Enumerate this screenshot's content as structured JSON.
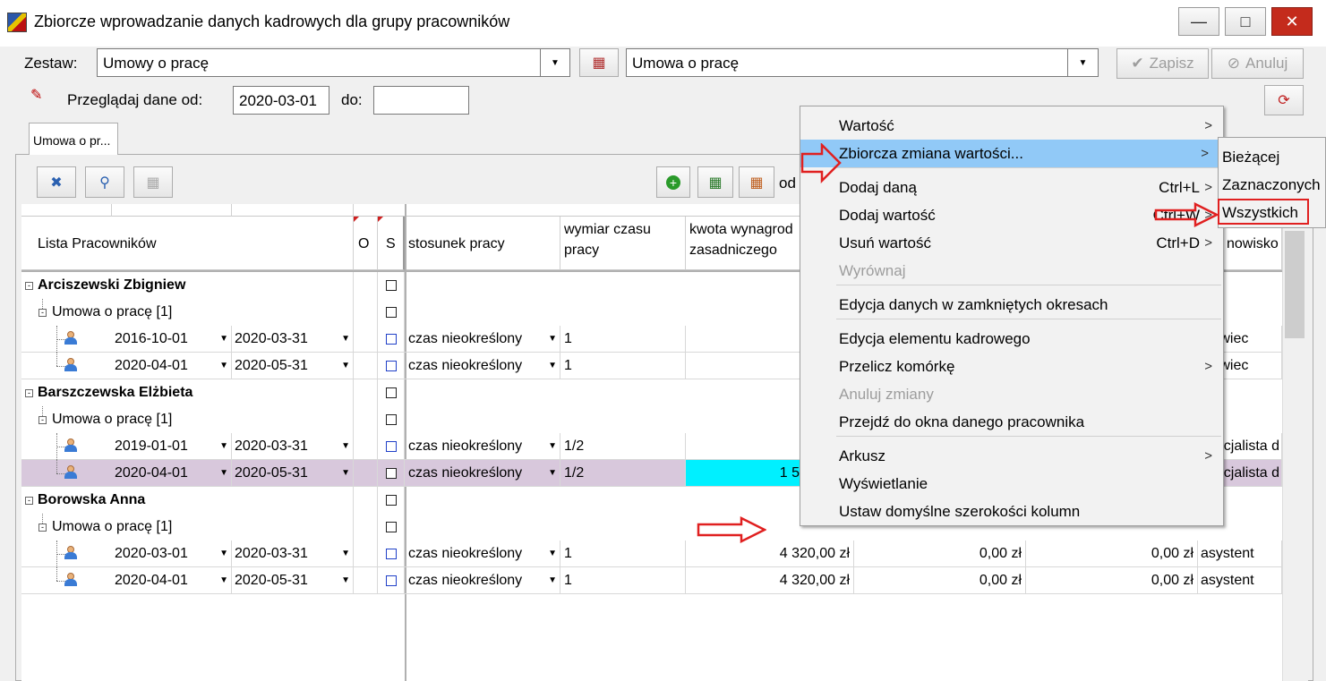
{
  "window": {
    "title": "Zbiorcze wprowadzanie danych kadrowych dla grupy pracowników"
  },
  "form": {
    "zestaw_label": "Zestaw:",
    "zestaw_value": "Umowy o pracę",
    "element_value": "Umowa o pracę",
    "save_label": "Zapisz",
    "cancel_label": "Anuluj",
    "browse_from_label": "Przeglądaj dane od:",
    "date_from": "2020-03-01",
    "to_label": "do:",
    "date_to": ""
  },
  "tab": {
    "label": "Umowa o pr..."
  },
  "toolbar": {
    "od_label": "od"
  },
  "grid": {
    "headers": {
      "lista": "Lista Pracowników",
      "o": "O",
      "s": "S",
      "stosunek": "stosunek pracy",
      "wymiar_line1": "wymiar czasu",
      "wymiar_line2": "pracy",
      "kwota_line1": "kwota wynagrod",
      "kwota_line2": "zasadniczego",
      "stanowisko_partial": "nowisko"
    },
    "employees": [
      {
        "name": "Arciszewski Zbigniew",
        "contract": "Umowa o pracę [1]",
        "rows": [
          {
            "from": "2016-10-01",
            "to": "2020-03-31",
            "stosunek": "czas nieokreślony",
            "wymiar": "1",
            "kwota": "3 5",
            "k2": "",
            "k3": "",
            "stanowisko": "dlowiec"
          },
          {
            "from": "2020-04-01",
            "to": "2020-05-31",
            "stosunek": "czas nieokreślony",
            "wymiar": "1",
            "kwota": "3 5",
            "k2": "",
            "k3": "",
            "stanowisko": "dlowiec"
          }
        ]
      },
      {
        "name": "Barszczewska Elżbieta",
        "contract": "Umowa o pracę [1]",
        "rows": [
          {
            "from": "2019-01-01",
            "to": "2020-03-31",
            "stosunek": "czas nieokreślony",
            "wymiar": "1/2",
            "kwota": "1 5",
            "k2": "",
            "k3": "",
            "stanowisko": "specjalista d"
          },
          {
            "from": "2020-04-01",
            "to": "2020-05-31",
            "stosunek": "czas nieokreślony",
            "wymiar": "1/2",
            "kwota": "1 500,00 zł",
            "k2": "0,00 zł",
            "k3": "0,00 zł",
            "stanowisko": "specjalista d"
          }
        ]
      },
      {
        "name": "Borowska Anna",
        "contract": "Umowa o pracę [1]",
        "rows": [
          {
            "from": "2020-03-01",
            "to": "2020-03-31",
            "stosunek": "czas nieokreślony",
            "wymiar": "1",
            "kwota": "4 320,00 zł",
            "k2": "0,00 zł",
            "k3": "0,00 zł",
            "stanowisko": "asystent"
          },
          {
            "from": "2020-04-01",
            "to": "2020-05-31",
            "stosunek": "czas nieokreślony",
            "wymiar": "1",
            "kwota": "4 320,00 zł",
            "k2": "0,00 zł",
            "k3": "0,00 zł",
            "stanowisko": "asystent"
          }
        ]
      }
    ]
  },
  "menu": {
    "items": [
      {
        "label": "Wartość",
        "shortcut": "",
        "arrow": ">"
      },
      {
        "label": "Zbiorcza zmiana wartości...",
        "shortcut": "",
        "arrow": ">"
      },
      {
        "label": "Dodaj daną",
        "shortcut": "Ctrl+L",
        "arrow": ">"
      },
      {
        "label": "Dodaj wartość",
        "shortcut": "Ctrl+W",
        "arrow": ">"
      },
      {
        "label": "Usuń wartość",
        "shortcut": "Ctrl+D",
        "arrow": ">"
      },
      {
        "label": "Wyrównaj",
        "shortcut": "",
        "arrow": ""
      },
      {
        "label": "Edycja danych w zamkniętych okresach",
        "shortcut": "",
        "arrow": ""
      },
      {
        "label": "Edycja elementu kadrowego",
        "shortcut": "",
        "arrow": ""
      },
      {
        "label": "Przelicz komórkę",
        "shortcut": "",
        "arrow": ">"
      },
      {
        "label": "Anuluj zmiany",
        "shortcut": "",
        "arrow": ""
      },
      {
        "label": "Przejdź do okna danego pracownika",
        "shortcut": "",
        "arrow": ""
      },
      {
        "label": "Arkusz",
        "shortcut": "",
        "arrow": ">"
      },
      {
        "label": "Wyświetlanie",
        "shortcut": "",
        "arrow": ""
      },
      {
        "label": "Ustaw domyślne szerokości kolumn",
        "shortcut": "",
        "arrow": ""
      }
    ],
    "submenu": [
      "Bieżącej",
      "Zaznaczonych",
      "Wszystkich"
    ]
  },
  "colors": {
    "highlight": "#91c9f7",
    "annotation": "#e02020",
    "cell_active": "#00f0ff",
    "row_selected": "#d8c8dc"
  }
}
